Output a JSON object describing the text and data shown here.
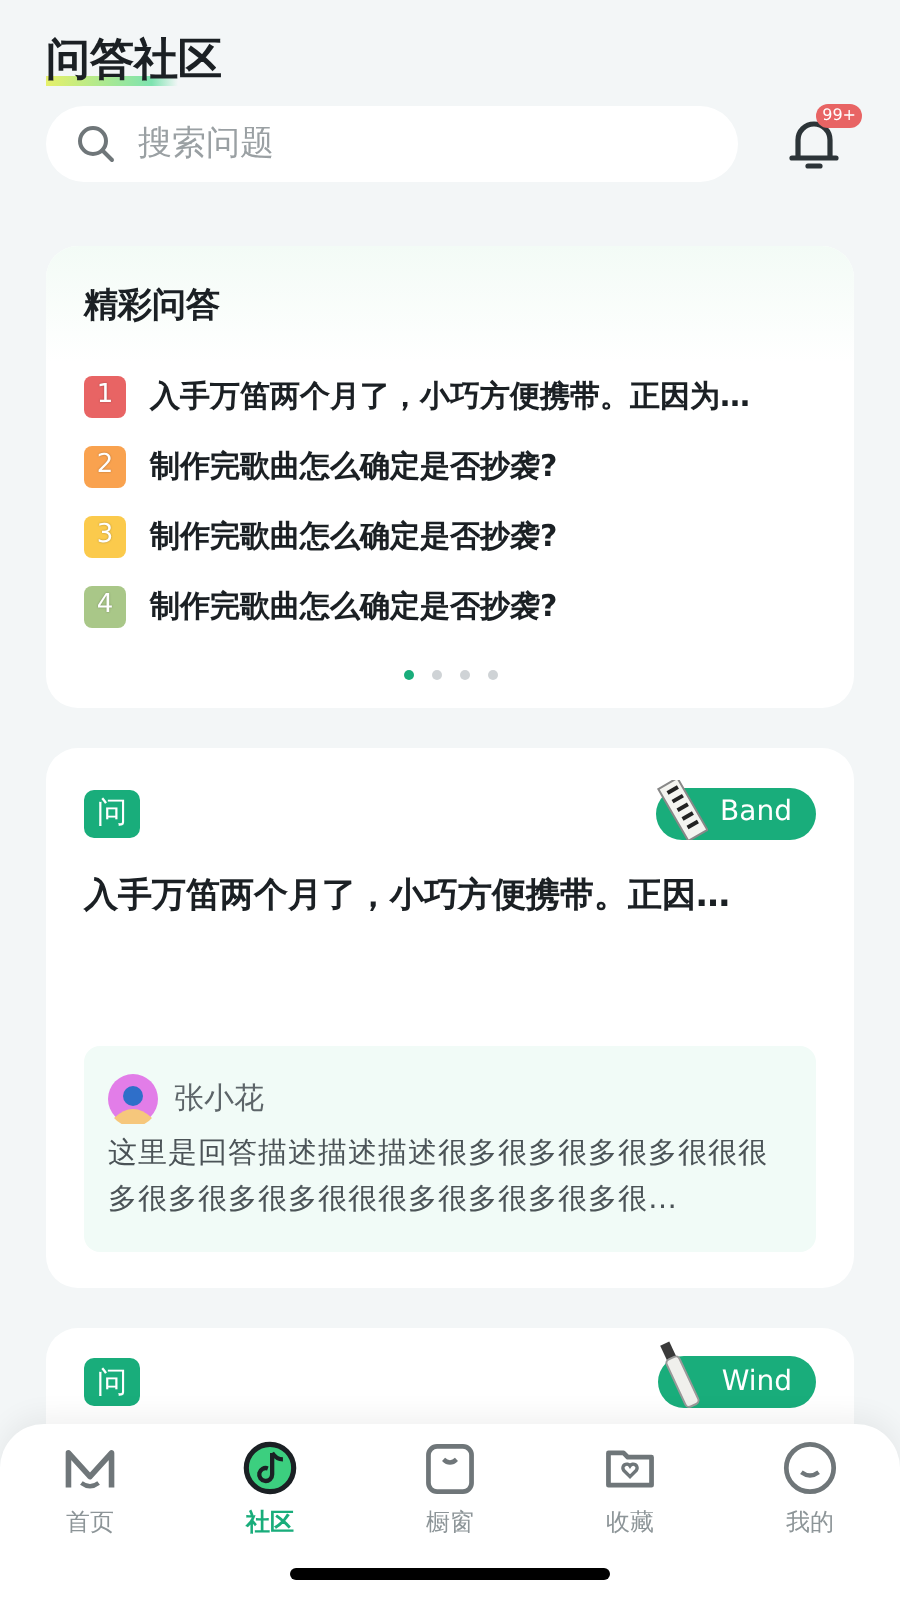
{
  "header": {
    "title": "问答社区"
  },
  "search": {
    "placeholder": "搜索问题"
  },
  "notifications": {
    "badge": "99+"
  },
  "featured": {
    "title": "精彩问答",
    "items": [
      {
        "rank": "1",
        "color": "#e86464",
        "text": "入手万笛两个月了，小巧方便携带。正因为…"
      },
      {
        "rank": "2",
        "color": "#f9a24f",
        "text": "制作完歌曲怎么确定是否抄袭?"
      },
      {
        "rank": "3",
        "color": "#fbca4c",
        "text": "制作完歌曲怎么确定是否抄袭?"
      },
      {
        "rank": "4",
        "color": "#a9c788",
        "text": "制作完歌曲怎么确定是否抄袭?"
      }
    ],
    "dots": [
      {
        "selected": true
      },
      {
        "selected": false
      },
      {
        "selected": false
      },
      {
        "selected": false
      }
    ]
  },
  "questions": [
    {
      "mark": "问",
      "tag": "Band",
      "kind": "keyboard",
      "title": "入手万笛两个月了，小巧方便携带。正因…",
      "answer": {
        "author": "张小花",
        "text": "这里是回答描述描述描述很多很多很多很多很很很多很多很多很多很很很多很多很多很多很…"
      }
    },
    {
      "mark": "问",
      "tag": "Wind",
      "kind": "flute"
    }
  ],
  "tabbar": [
    {
      "label": "首页",
      "selected": false
    },
    {
      "label": "社区",
      "selected": true
    },
    {
      "label": "橱窗",
      "selected": false
    },
    {
      "label": "收藏",
      "selected": false
    },
    {
      "label": "我的",
      "selected": false
    }
  ]
}
